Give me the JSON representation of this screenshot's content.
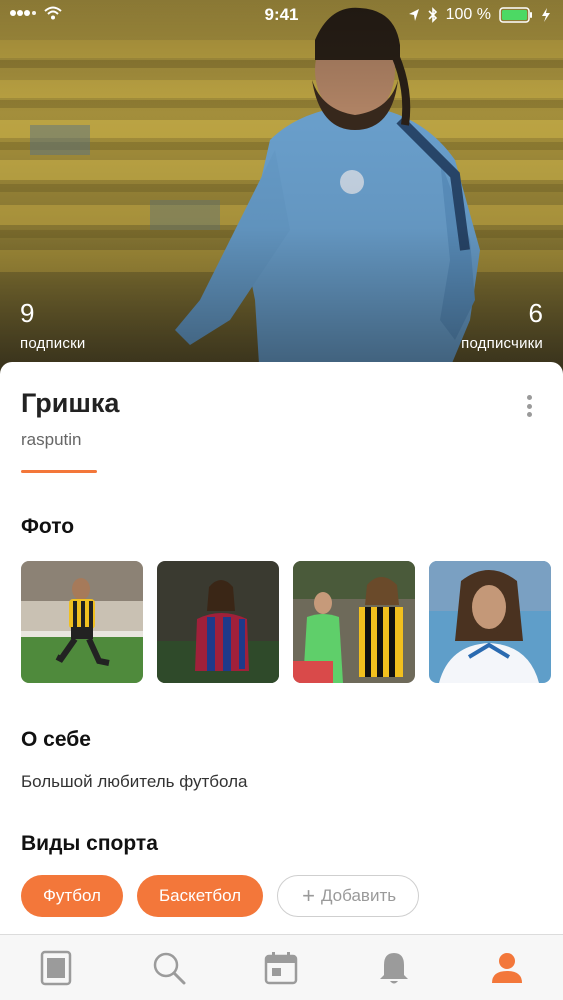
{
  "status_bar": {
    "time": "9:41",
    "battery": "100 %",
    "icons": [
      "signal-icon",
      "wifi-icon",
      "location-icon",
      "bluetooth-icon",
      "battery-icon",
      "charging-icon"
    ]
  },
  "profile": {
    "following_count": "9",
    "following_label": "подписки",
    "followers_count": "6",
    "followers_label": "подписчики",
    "name": "Гришка",
    "username": "rasputin"
  },
  "photos": {
    "title": "Фото",
    "items": [
      "photo-1",
      "photo-2",
      "photo-3",
      "photo-4"
    ]
  },
  "about": {
    "title": "О себе",
    "text": "Большой любитель футбола"
  },
  "sports": {
    "title": "Виды спорта",
    "items": [
      "Футбол",
      "Баскетбол"
    ],
    "add_label": "Добавить"
  },
  "tabbar": {
    "items": [
      "feed-icon",
      "search-icon",
      "calendar-icon",
      "notifications-icon",
      "profile-icon"
    ],
    "active": "profile-icon"
  },
  "colors": {
    "accent": "#f3773a",
    "tab_inactive": "#9b9b9b"
  }
}
